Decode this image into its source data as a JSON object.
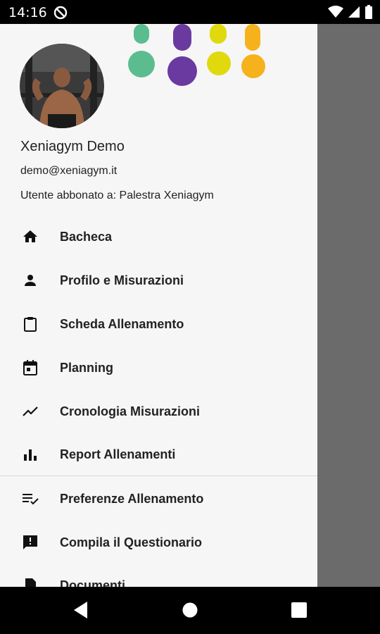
{
  "status": {
    "time": "14:16"
  },
  "profile": {
    "name": "Xeniagym Demo",
    "email": "demo@xeniagym.it",
    "subscription": "Utente abbonato a: Palestra Xeniagym"
  },
  "menu": [
    {
      "label": "Bacheca",
      "icon": "home-icon"
    },
    {
      "label": "Profilo e Misurazioni",
      "icon": "person-icon"
    },
    {
      "label": "Scheda Allenamento",
      "icon": "clipboard-icon"
    },
    {
      "label": "Planning",
      "icon": "calendar-icon"
    },
    {
      "label": "Cronologia Misurazioni",
      "icon": "trend-icon"
    },
    {
      "label": "Report Allenamenti",
      "icon": "bar-chart-icon"
    },
    {
      "label": "Preferenze Allenamento",
      "icon": "playlist-check-icon"
    },
    {
      "label": "Compila il Questionario",
      "icon": "feedback-icon"
    },
    {
      "label": "Documenti",
      "icon": "document-icon"
    }
  ],
  "colors": {
    "green": "#5bbd8f",
    "purple": "#6a3aa0",
    "yellow": "#e0d90e",
    "orange": "#f6b21d"
  }
}
